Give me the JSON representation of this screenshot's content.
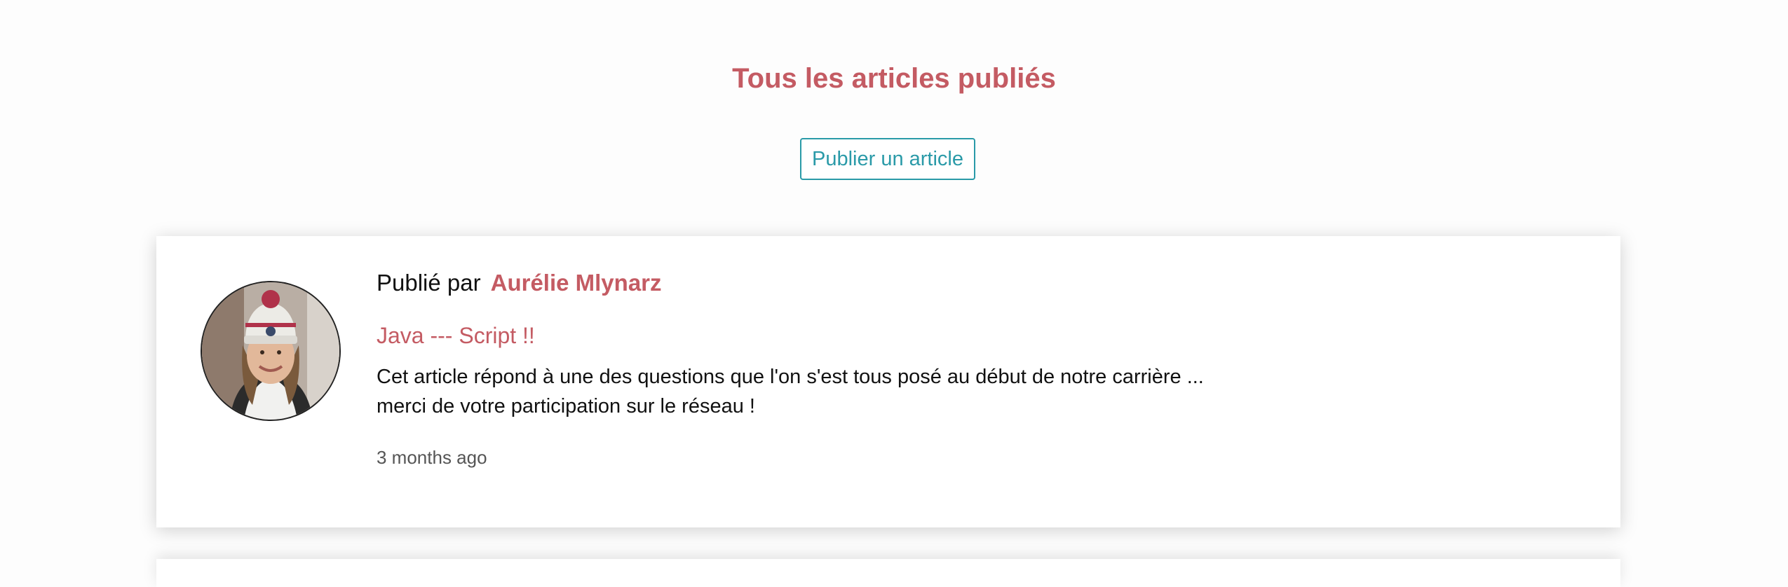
{
  "header": {
    "title": "Tous les articles publiés",
    "publish_button": "Publier un article"
  },
  "article": {
    "byline_prefix": "Publié par",
    "author": "Aurélie Mlynarz",
    "title": "Java --- Script !!",
    "excerpt_line1": "Cet article répond à une des questions que l'on s'est tous posé au début de notre carrière ...",
    "excerpt_line2": "merci de votre participation sur le réseau !",
    "timestamp": "3 months ago"
  },
  "colors": {
    "accent": "#c45b63",
    "button": "#2a9aa8"
  }
}
